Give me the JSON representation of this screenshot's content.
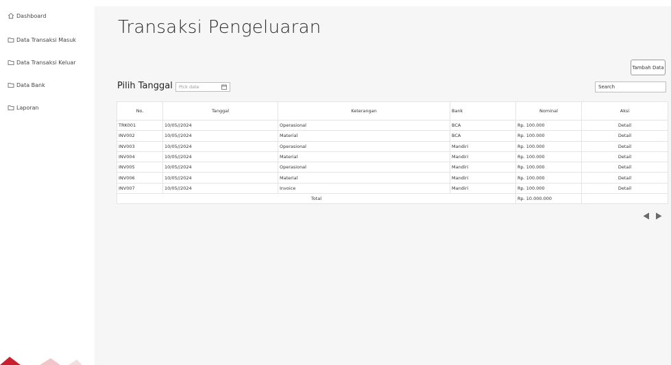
{
  "sidebar": {
    "items": [
      {
        "label": "Dashboard",
        "icon": "home-icon"
      },
      {
        "label": "Data Transaksi Masuk",
        "icon": "folder-icon"
      },
      {
        "label": "Data Transaksi Keluar",
        "icon": "folder-icon"
      },
      {
        "label": "Data Bank",
        "icon": "folder-icon"
      },
      {
        "label": "Laporan",
        "icon": "folder-icon"
      }
    ]
  },
  "main": {
    "title": "Transaksi Pengeluaran",
    "add_button": "Tambah Data",
    "date_label": "Pilih Tanggal",
    "date_placeholder": "Pick date",
    "search_value": "Search"
  },
  "table": {
    "headers": [
      "No.",
      "Tanggal",
      "Keterangan",
      "Bank",
      "Nominal",
      "Aksi"
    ],
    "rows": [
      [
        "TRK001",
        "10/05//2024",
        "Operasional",
        "BCA",
        "Rp. 100.000",
        "Detail"
      ],
      [
        "INV002",
        "10/05//2024",
        "Material",
        "BCA",
        "Rp. 100.000",
        "Detail"
      ],
      [
        "INV003",
        "10/05//2024",
        "Operasional",
        "Mandiri",
        "Rp. 100.000",
        "Detail"
      ],
      [
        "INV004",
        "10/05//2024",
        "Material",
        "Mandiri",
        "Rp. 100.000",
        "Detail"
      ],
      [
        "INV005",
        "10/05//2024",
        "Operasional",
        "Mandiri",
        "Rp. 100.000",
        "Detail"
      ],
      [
        "INV006",
        "10/05//2024",
        "Material",
        "Mandiri",
        "Rp. 100.000",
        "Detail"
      ],
      [
        "INV007",
        "10/05//2024",
        "Invoice",
        "Mandiri",
        "Rp. 100.000",
        "Detail"
      ]
    ],
    "total_label": "Total",
    "total_value": "Rp. 10.000.000"
  },
  "colors": {
    "sidebar_bg": "#ffffff",
    "main_bg": "#f6f6f6",
    "logo_red": "#c8202f"
  }
}
